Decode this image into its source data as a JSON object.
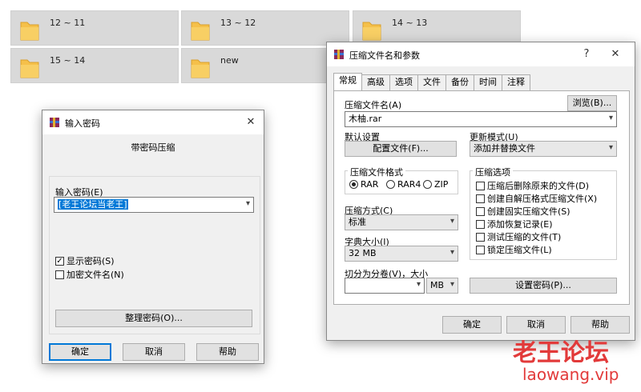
{
  "folders": [
    {
      "label": "12 ~ 11"
    },
    {
      "label": "13 ~ 12"
    },
    {
      "label": "14 ~ 13"
    },
    {
      "label": "15 ~ 14"
    },
    {
      "label": "new"
    }
  ],
  "password_dialog": {
    "title": "输入密码",
    "heading": "带密码压缩",
    "password_label": "输入密码(E)",
    "password_value": "[老王论坛当老王]",
    "show_password": "显示密码(S)",
    "encrypt_names": "加密文件名(N)",
    "organize_button": "整理密码(O)...",
    "ok": "确定",
    "cancel": "取消",
    "help": "帮助"
  },
  "archive_dialog": {
    "title": "压缩文件名和参数",
    "help_glyph": "?",
    "tabs": [
      "常规",
      "高级",
      "选项",
      "文件",
      "备份",
      "时间",
      "注释"
    ],
    "archive_name_label": "压缩文件名(A)",
    "archive_name_value": "木柚.rar",
    "browse": "浏览(B)...",
    "default_settings": "默认设置",
    "profiles_button": "配置文件(F)...",
    "update_mode_label": "更新模式(U)",
    "update_mode_value": "添加并替换文件",
    "format_group": "压缩文件格式",
    "format_rar": "RAR",
    "format_rar4": "RAR4",
    "format_zip": "ZIP",
    "method_label": "压缩方式(C)",
    "method_value": "标准",
    "dict_label": "字典大小(I)",
    "dict_value": "32 MB",
    "split_label": "切分为分卷(V)，大小",
    "split_unit": "MB",
    "options_group": "压缩选项",
    "options": [
      "压缩后删除原来的文件(D)",
      "创建自解压格式压缩文件(X)",
      "创建固实压缩文件(S)",
      "添加恢复记录(E)",
      "测试压缩的文件(T)",
      "锁定压缩文件(L)"
    ],
    "set_password": "设置密码(P)...",
    "ok": "确定",
    "cancel": "取消",
    "help": "帮助"
  },
  "watermark": {
    "title": "老王论坛",
    "url": "laowang.vip"
  },
  "colors": {
    "accent": "#0078d7",
    "watermark": "#e23a3a",
    "folder": "#f5c04a"
  }
}
